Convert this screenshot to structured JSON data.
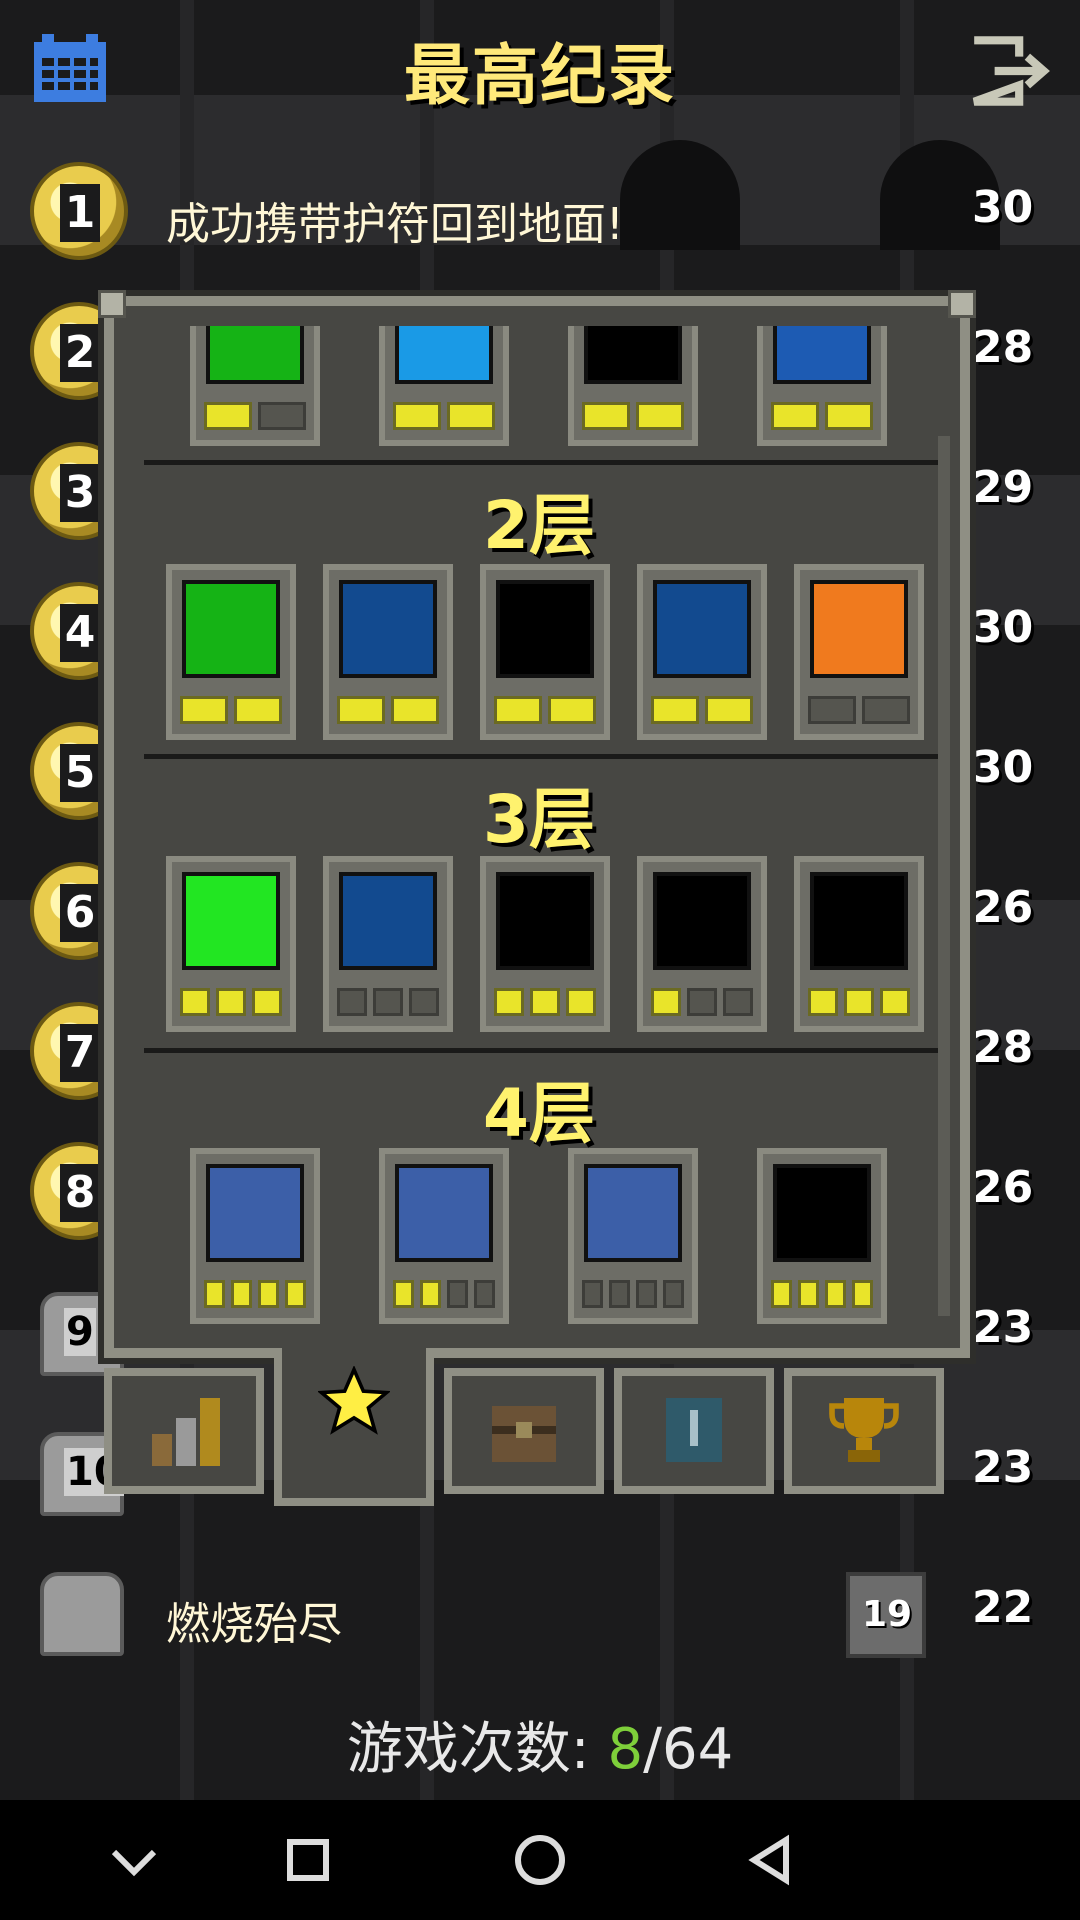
{
  "header": {
    "title": "最高纪录",
    "calendar_icon": "calendar-icon",
    "exit_icon": "exit-icon"
  },
  "rankings": [
    {
      "rank": "1",
      "text": "成功携带护符回到地面!",
      "level": "30"
    },
    {
      "rank": "2",
      "level": "28"
    },
    {
      "rank": "3",
      "level": "29"
    },
    {
      "rank": "4",
      "level": "30"
    },
    {
      "rank": "5",
      "level": "30"
    },
    {
      "rank": "6",
      "level": "26"
    },
    {
      "rank": "7",
      "level": "28"
    },
    {
      "rank": "8",
      "level": "26"
    },
    {
      "rank": "9",
      "level": "23"
    },
    {
      "rank": "10",
      "level": "23"
    }
  ],
  "last_row": {
    "text": "燃烧殆尽",
    "depth": "19",
    "level": "22"
  },
  "badges": {
    "tiers": [
      {
        "title": "2层"
      },
      {
        "title": "3层"
      },
      {
        "title": "4层"
      }
    ]
  },
  "tabs": [
    {
      "name": "stats-tab"
    },
    {
      "name": "badges-tab",
      "active": true
    },
    {
      "name": "items-tab"
    },
    {
      "name": "journal-tab"
    },
    {
      "name": "trophy-tab"
    }
  ],
  "footer": {
    "games_label": "游戏次数:",
    "games_current": "8",
    "games_total": "/64"
  },
  "colors": {
    "title": "#ffe97a",
    "accent_green": "#7ecf3a",
    "badge_yellow": "#e9e42a"
  }
}
